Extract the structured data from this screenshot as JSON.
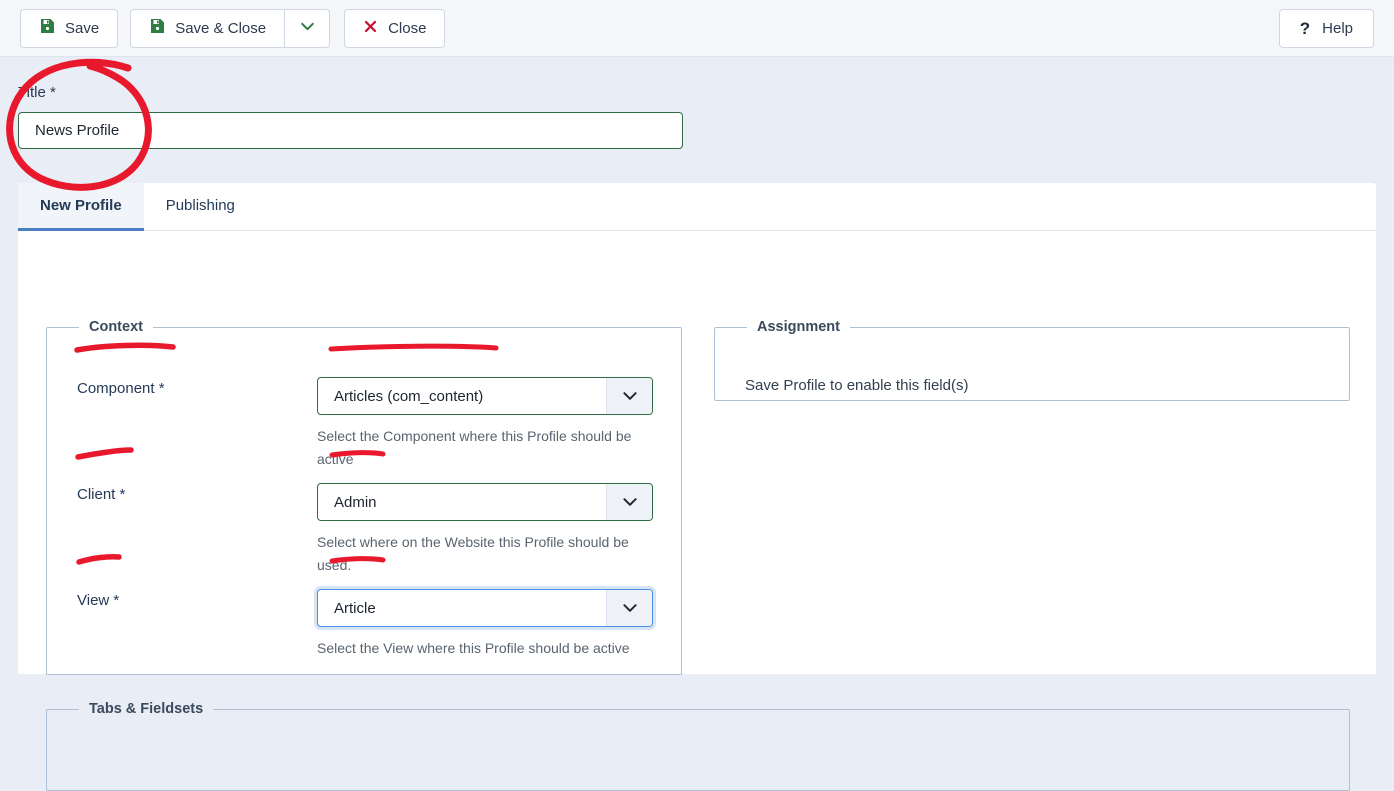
{
  "toolbar": {
    "save_label": "Save",
    "save_close_label": "Save & Close",
    "save_close_dropdown_icon": "chevron-down-icon",
    "close_label": "Close",
    "close_icon": "x-icon",
    "save_icon": "floppy-disk-icon",
    "help_label": "Help",
    "help_icon": "question-mark-icon"
  },
  "title_field": {
    "label": "Title *",
    "value": "News Profile",
    "placeholder": ""
  },
  "tabs": [
    {
      "label": "New Profile",
      "active": true
    },
    {
      "label": "Publishing",
      "active": false
    }
  ],
  "context": {
    "legend": "Context",
    "fields": [
      {
        "label": "Component *",
        "value": "Articles (com_content)",
        "description": "Select the Component where this Profile should be active",
        "focused": false
      },
      {
        "label": "Client *",
        "value": "Admin",
        "description": "Select where on the Website this Profile should be used.",
        "focused": false
      },
      {
        "label": "View *",
        "value": "Article",
        "description": "Select the View where this Profile should be active",
        "focused": true
      }
    ]
  },
  "assignment": {
    "legend": "Assignment",
    "note": "Save Profile to enable this field(s)"
  },
  "tabs_fieldsets": {
    "legend": "Tabs & Fieldsets"
  },
  "annotations": {
    "color": "#e8192c",
    "marks": [
      "circle-around-title-field",
      "underline-component-label",
      "underline-component-value",
      "underline-client-label",
      "underline-client-value",
      "underline-view-label",
      "underline-view-value"
    ]
  },
  "colors": {
    "page_background": "#e9edf5",
    "toolbar_background": "#f4f6f9",
    "panel_background": "#ffffff",
    "valid_border": "#2f6b43",
    "focus_border": "#4a90e2",
    "active_tab_underline": "#4a7fc1",
    "label_text": "#253a56",
    "annotation_red": "#e8192c"
  }
}
